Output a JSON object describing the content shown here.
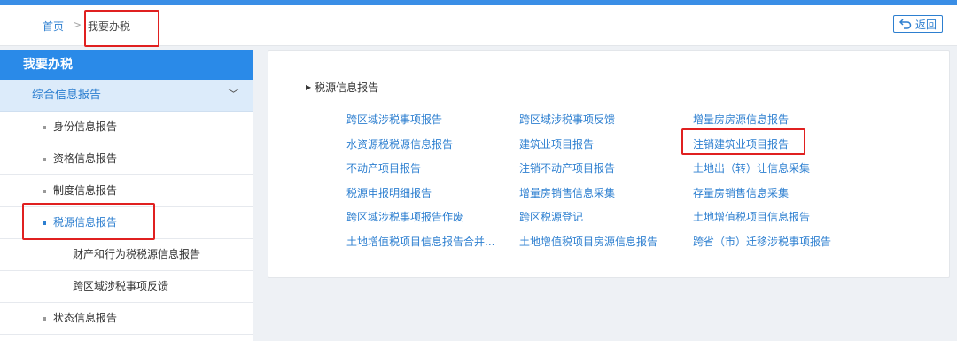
{
  "breadcrumb": {
    "home": "首页",
    "separator": ">",
    "current": "我要办税"
  },
  "back_button": {
    "label": "返回",
    "icon": "return-arrow-icon"
  },
  "sidebar": {
    "title": "我要办税",
    "group": {
      "label": "综合信息报告",
      "chevron": "﹀"
    },
    "items": [
      {
        "label": "身份信息报告"
      },
      {
        "label": "资格信息报告"
      },
      {
        "label": "制度信息报告"
      },
      {
        "label": "税源信息报告",
        "active": true
      },
      {
        "label": "财产和行为税税源信息报告",
        "sub": true
      },
      {
        "label": "跨区域涉税事项反馈",
        "sub": true
      },
      {
        "label": "状态信息报告"
      }
    ]
  },
  "panel": {
    "section_title": "税源信息报告",
    "links": [
      [
        "跨区域涉税事项报告",
        "跨区域涉税事项反馈",
        "增量房房源信息报告"
      ],
      [
        "水资源税税源信息报告",
        "建筑业项目报告",
        "注销建筑业项目报告"
      ],
      [
        "不动产项目报告",
        "注销不动产项目报告",
        "土地出（转）让信息采集"
      ],
      [
        "税源申报明细报告",
        "增量房销售信息采集",
        "存量房销售信息采集"
      ],
      [
        "跨区域涉税事项报告作废",
        "跨区税源登记",
        "土地增值税项目信息报告"
      ],
      [
        "土地增值税项目信息报告合并...",
        "土地增值税项目房源信息报告",
        "跨省（市）迁移涉税事项报告"
      ]
    ]
  },
  "colors": {
    "accent": "#2a8ae8",
    "link": "#2d7fd0",
    "highlight_box": "#e02020"
  }
}
